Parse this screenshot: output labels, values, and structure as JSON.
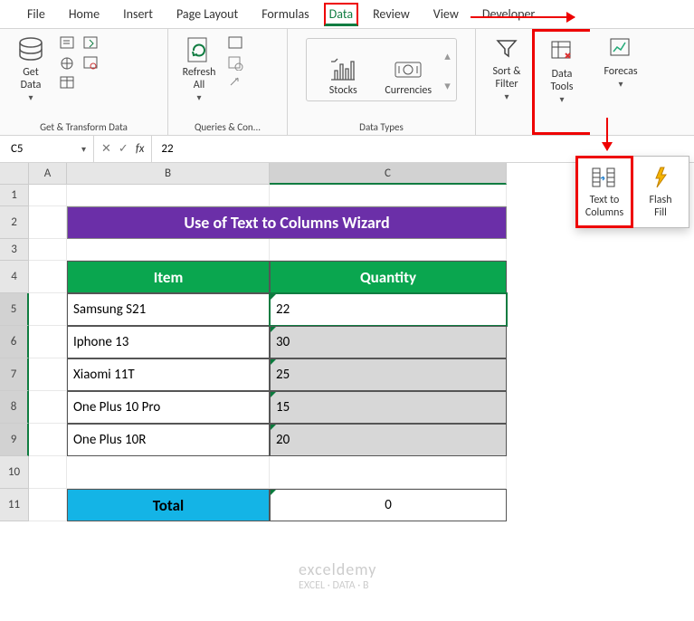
{
  "tabs": {
    "file": "File",
    "home": "Home",
    "insert": "Insert",
    "page_layout": "Page Layout",
    "formulas": "Formulas",
    "data": "Data",
    "review": "Review",
    "view": "View",
    "developer": "Developer"
  },
  "ribbon": {
    "get_transform": {
      "get_data": "Get\nData",
      "label": "Get & Transform Data"
    },
    "queries": {
      "refresh_all": "Refresh\nAll",
      "label": "Queries & Con..."
    },
    "datatypes": {
      "stocks": "Stocks",
      "currencies": "Currencies",
      "label": "Data Types"
    },
    "sort_filter": "Sort &\nFilter",
    "data_tools": "Data\nTools",
    "forecast": "Forecas"
  },
  "popover": {
    "text_to_columns": "Text to\nColumns",
    "flash_fill": "Flash\nFill"
  },
  "namebox": "C5",
  "formula_value": "22",
  "cols": {
    "a": "A",
    "b": "B",
    "c": "C"
  },
  "rows": [
    "1",
    "2",
    "3",
    "4",
    "5",
    "6",
    "7",
    "8",
    "9",
    "10",
    "11"
  ],
  "sheet": {
    "title": "Use of Text to Columns Wizard",
    "headers": {
      "item": "Item",
      "qty": "Quantity"
    },
    "data": [
      {
        "item": "Samsung S21",
        "qty": "22"
      },
      {
        "item": "Iphone 13",
        "qty": "30"
      },
      {
        "item": "Xiaomi 11T",
        "qty": "25"
      },
      {
        "item": "One Plus 10 Pro",
        "qty": "15"
      },
      {
        "item": "One Plus 10R",
        "qty": "20"
      }
    ],
    "total_label": "Total",
    "total_value": "0"
  },
  "watermark": {
    "brand": "exceldemy",
    "tag": "EXCEL · DATA · B"
  }
}
